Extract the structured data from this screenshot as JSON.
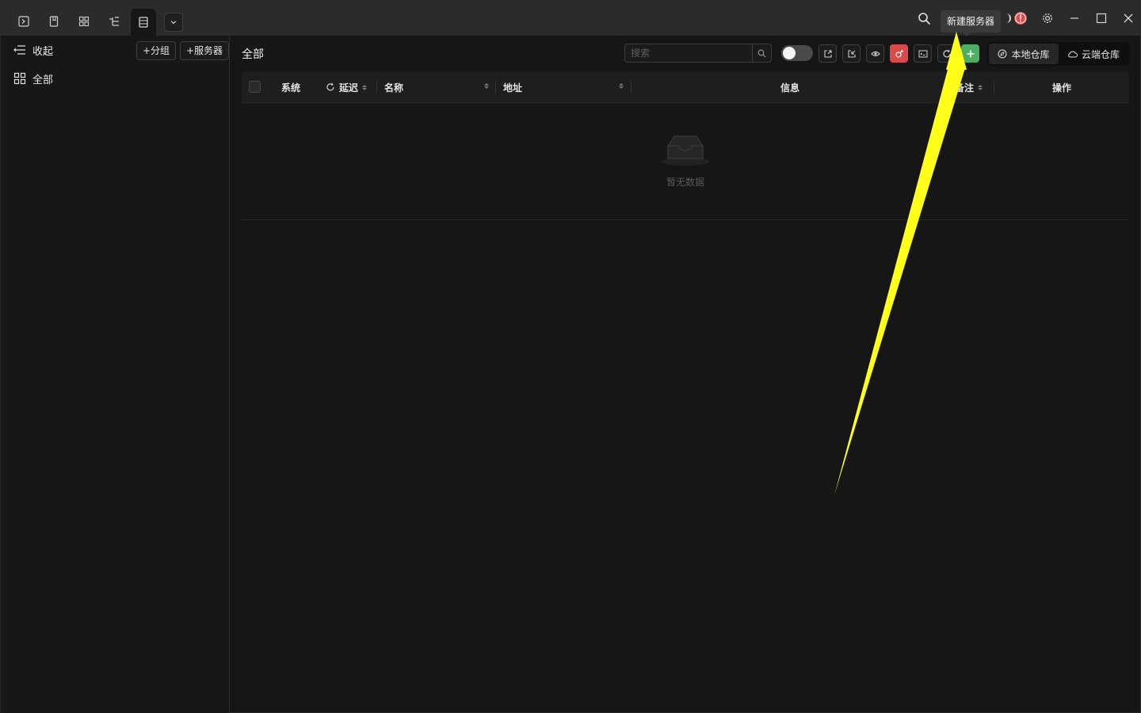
{
  "tooltip": "新建服务器",
  "sidebar": {
    "collapse_label": "收起",
    "add_group_label": "+分组",
    "add_server_label": "+服务器",
    "items": [
      {
        "label": "全部"
      }
    ]
  },
  "main": {
    "title": "全部",
    "search_placeholder": "搜索",
    "storage": {
      "local_label": "本地仓库",
      "cloud_label": "云端仓库"
    }
  },
  "table": {
    "columns": {
      "system": "系统",
      "latency": "延迟",
      "name": "名称",
      "address": "地址",
      "info": "信息",
      "note": "备注",
      "action": "操作"
    },
    "empty_text": "暂无数据"
  },
  "colors": {
    "accent_green": "#4caf63",
    "accent_red": "#d94a4a",
    "annotation_arrow": "#ffff00"
  }
}
